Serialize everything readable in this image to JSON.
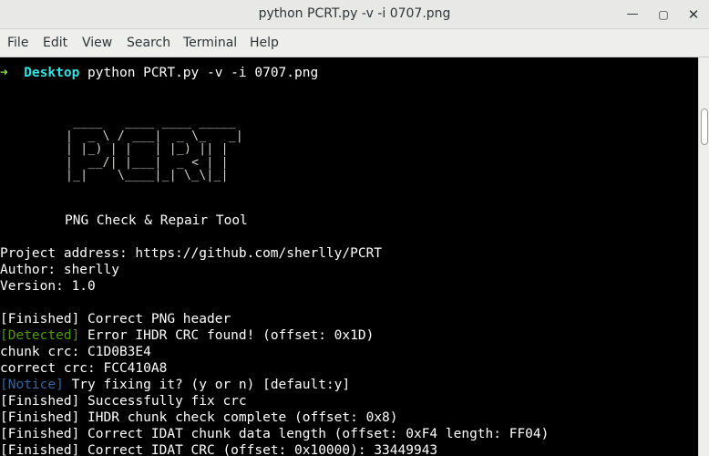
{
  "window": {
    "title": "python PCRT.py -v -i 0707.png"
  },
  "menu": [
    "File",
    "Edit",
    "View",
    "Search",
    "Terminal",
    "Help"
  ],
  "terminal": {
    "prompt_arrow": "➜",
    "prompt_dir": "Desktop",
    "command": "python PCRT.py -v -i 0707.png",
    "logo_ascii": " ____   ____ ____ _____\n|  _ \\ / ___|  _ \\_   _|\n| |_) | |   | |_) || |\n|  __/| |___|  _ < | |\n|_|    \\____|_| \\_\\|_|",
    "tool_name": "PNG Check & Repair Tool",
    "project_line": "Project address: https://github.com/sherlly/PCRT",
    "author_line": "Author: sherlly",
    "version_line": "Version: 1.0",
    "log": [
      {
        "tag": "[Finished]",
        "text": " Correct PNG header",
        "style": "white"
      },
      {
        "tag": "[Detected]",
        "text": " Error IHDR CRC found! (offset: 0x1D)",
        "style": "green"
      },
      {
        "tag": "",
        "text": "chunk crc: C1D0B3E4",
        "style": "white"
      },
      {
        "tag": "",
        "text": "correct crc: FCC410A8",
        "style": "white"
      },
      {
        "tag": "[Notice]",
        "text": " Try fixing it? (y or n) [default:y]",
        "style": "blue"
      },
      {
        "tag": "[Finished]",
        "text": " Successfully fix crc",
        "style": "white"
      },
      {
        "tag": "[Finished]",
        "text": " IHDR chunk check complete (offset: 0x8)",
        "style": "white"
      },
      {
        "tag": "[Finished]",
        "text": " Correct IDAT chunk data length (offset: 0xF4 length: FF04)",
        "style": "white"
      },
      {
        "tag": "[Finished]",
        "text": " Correct IDAT CRC (offset: 0x10000): 33449943",
        "style": "white"
      }
    ]
  }
}
